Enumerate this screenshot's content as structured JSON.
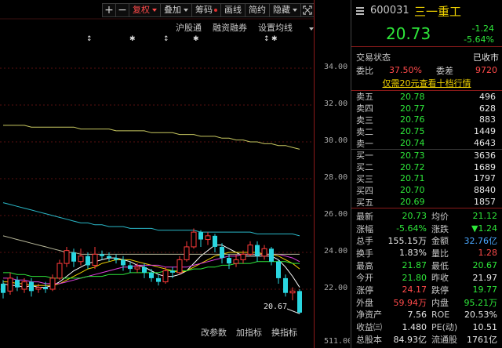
{
  "toolbar": {
    "plus": "+",
    "minus": "−",
    "restore_right": "复权",
    "overlay": "叠加",
    "chips": "筹码",
    "drawing": "画线",
    "brief": "简约",
    "hide": "隐藏"
  },
  "subbar": {
    "hsgt": "沪股通",
    "margin": "融资融券",
    "ma_settings": "设置均线"
  },
  "bottom_tools": {
    "edit_params": "改参数",
    "add_indicator": "加指标",
    "switch_indicator": "换指标"
  },
  "price_axis": {
    "ticks": [
      "34.00",
      "32.00",
      "30.00",
      "28.00",
      "26.00",
      "24.00",
      "22.00"
    ],
    "bottom_label": "511.00"
  },
  "chart_annotation": {
    "low_price": "20.67"
  },
  "chart_data": {
    "type": "candlestick",
    "ylim": [
      20.0,
      35.0
    ],
    "candles": [
      {
        "o": 22.3,
        "c": 21.8,
        "h": 22.5,
        "l": 21.5
      },
      {
        "o": 21.9,
        "c": 22.6,
        "h": 22.9,
        "l": 21.7
      },
      {
        "o": 22.5,
        "c": 22.1,
        "h": 22.7,
        "l": 21.9
      },
      {
        "o": 22.0,
        "c": 22.4,
        "h": 22.6,
        "l": 21.8
      },
      {
        "o": 22.4,
        "c": 21.9,
        "h": 22.6,
        "l": 21.6
      },
      {
        "o": 22.0,
        "c": 22.1,
        "h": 22.3,
        "l": 21.8
      },
      {
        "o": 22.1,
        "c": 22.0,
        "h": 22.4,
        "l": 21.8
      },
      {
        "o": 22.0,
        "c": 22.6,
        "h": 22.8,
        "l": 21.9
      },
      {
        "o": 22.6,
        "c": 23.4,
        "h": 23.6,
        "l": 22.5
      },
      {
        "o": 23.4,
        "c": 24.1,
        "h": 24.3,
        "l": 23.2
      },
      {
        "o": 24.0,
        "c": 23.5,
        "h": 24.2,
        "l": 23.2
      },
      {
        "o": 23.5,
        "c": 23.8,
        "h": 24.2,
        "l": 23.3
      },
      {
        "o": 23.8,
        "c": 23.3,
        "h": 24.0,
        "l": 23.1
      },
      {
        "o": 23.3,
        "c": 23.9,
        "h": 24.3,
        "l": 23.1
      },
      {
        "o": 23.9,
        "c": 23.8,
        "h": 24.1,
        "l": 23.6
      },
      {
        "o": 23.8,
        "c": 23.7,
        "h": 24.0,
        "l": 23.5
      },
      {
        "o": 23.7,
        "c": 23.6,
        "h": 23.9,
        "l": 23.4
      },
      {
        "o": 23.6,
        "c": 23.3,
        "h": 23.8,
        "l": 23.0
      },
      {
        "o": 23.3,
        "c": 23.1,
        "h": 23.5,
        "l": 22.9
      },
      {
        "o": 23.1,
        "c": 23.2,
        "h": 23.4,
        "l": 22.9
      },
      {
        "o": 23.2,
        "c": 22.9,
        "h": 23.4,
        "l": 22.6
      },
      {
        "o": 22.9,
        "c": 22.6,
        "h": 23.1,
        "l": 22.4
      },
      {
        "o": 22.6,
        "c": 22.4,
        "h": 22.8,
        "l": 22.2
      },
      {
        "o": 22.4,
        "c": 23.0,
        "h": 23.2,
        "l": 22.3
      },
      {
        "o": 23.0,
        "c": 22.9,
        "h": 23.2,
        "l": 22.6
      },
      {
        "o": 22.9,
        "c": 23.6,
        "h": 23.8,
        "l": 22.8
      },
      {
        "o": 23.6,
        "c": 24.3,
        "h": 24.6,
        "l": 23.5
      },
      {
        "o": 24.3,
        "c": 25.1,
        "h": 25.3,
        "l": 24.2
      },
      {
        "o": 25.1,
        "c": 24.7,
        "h": 25.2,
        "l": 24.3
      },
      {
        "o": 24.7,
        "c": 24.9,
        "h": 25.1,
        "l": 24.4
      },
      {
        "o": 24.9,
        "c": 24.3,
        "h": 25.0,
        "l": 24.0
      },
      {
        "o": 24.3,
        "c": 23.7,
        "h": 24.5,
        "l": 23.4
      },
      {
        "o": 23.7,
        "c": 23.4,
        "h": 23.9,
        "l": 23.1
      },
      {
        "o": 23.4,
        "c": 23.6,
        "h": 23.9,
        "l": 23.2
      },
      {
        "o": 23.6,
        "c": 23.9,
        "h": 24.1,
        "l": 23.4
      },
      {
        "o": 23.9,
        "c": 24.4,
        "h": 24.6,
        "l": 23.8
      },
      {
        "o": 24.4,
        "c": 23.8,
        "h": 24.6,
        "l": 23.5
      },
      {
        "o": 23.8,
        "c": 24.2,
        "h": 24.4,
        "l": 23.6
      },
      {
        "o": 24.2,
        "c": 23.5,
        "h": 24.3,
        "l": 23.3
      },
      {
        "o": 23.5,
        "c": 22.6,
        "h": 23.6,
        "l": 22.3
      },
      {
        "o": 22.6,
        "c": 21.8,
        "h": 22.8,
        "l": 21.6
      },
      {
        "o": 21.8,
        "c": 21.9,
        "h": 22.1,
        "l": 21.4
      },
      {
        "o": 21.9,
        "c": 20.73,
        "h": 22.0,
        "l": 20.67
      }
    ],
    "ma_lines": [
      {
        "color": "#ffffff",
        "values": [
          22.3,
          22.2,
          22.2,
          22.1,
          22.2,
          22.1,
          22.1,
          22.2,
          22.4,
          22.7,
          23.0,
          23.2,
          23.4,
          23.5,
          23.6,
          23.7,
          23.7,
          23.6,
          23.5,
          23.3,
          23.2,
          23.0,
          22.8,
          22.7,
          22.7,
          22.8,
          23.0,
          23.4,
          23.8,
          24.1,
          24.4,
          24.4,
          24.2,
          24.0,
          23.8,
          23.8,
          23.8,
          23.8,
          23.8,
          23.6,
          23.2,
          22.7,
          22.1
        ]
      },
      {
        "color": "#f0d200",
        "values": [
          22.4,
          22.4,
          22.3,
          22.3,
          22.2,
          22.2,
          22.2,
          22.2,
          22.3,
          22.5,
          22.7,
          22.9,
          23.1,
          23.2,
          23.4,
          23.5,
          23.6,
          23.6,
          23.6,
          23.5,
          23.4,
          23.3,
          23.2,
          23.1,
          23.0,
          22.9,
          23.0,
          23.2,
          23.4,
          23.6,
          23.8,
          23.9,
          24.0,
          24.0,
          24.0,
          24.0,
          24.0,
          23.9,
          23.9,
          23.8,
          23.6,
          23.4,
          23.1
        ]
      },
      {
        "color": "#e040e0",
        "values": [
          22.6,
          22.6,
          22.5,
          22.5,
          22.4,
          22.4,
          22.3,
          22.3,
          22.3,
          22.4,
          22.5,
          22.6,
          22.7,
          22.8,
          22.9,
          23.0,
          23.1,
          23.2,
          23.2,
          23.3,
          23.3,
          23.3,
          23.3,
          23.2,
          23.2,
          23.2,
          23.2,
          23.3,
          23.4,
          23.5,
          23.6,
          23.7,
          23.8,
          23.8,
          23.9,
          23.9,
          23.9,
          23.9,
          23.9,
          23.9,
          23.8,
          23.7,
          23.5
        ]
      },
      {
        "color": "#2ee83a",
        "values": [
          22.9,
          22.9,
          22.8,
          22.8,
          22.7,
          22.7,
          22.7,
          22.6,
          22.6,
          22.6,
          22.6,
          22.6,
          22.7,
          22.7,
          22.7,
          22.8,
          22.8,
          22.8,
          22.9,
          22.9,
          22.9,
          22.9,
          22.9,
          23.0,
          23.0,
          23.0,
          23.0,
          23.1,
          23.1,
          23.2,
          23.2,
          23.3,
          23.3,
          23.4,
          23.4,
          23.4,
          23.5,
          23.5,
          23.5,
          23.5,
          23.5,
          23.4,
          23.4
        ]
      },
      {
        "color": "#b8b89a",
        "values": [
          24.9,
          24.8,
          24.7,
          24.6,
          24.5,
          24.4,
          24.3,
          24.2,
          24.1,
          24.0,
          24.0,
          23.9,
          23.9,
          23.9,
          23.9,
          23.9,
          23.9,
          23.9,
          23.9,
          23.9,
          23.9,
          23.9,
          23.9,
          23.9,
          23.9,
          23.9,
          23.9,
          23.9,
          23.9,
          23.9,
          23.9,
          23.9,
          23.9,
          23.9,
          23.9,
          23.9,
          23.9,
          23.9,
          23.9,
          23.9,
          23.9,
          23.9,
          23.9
        ]
      },
      {
        "color": "#2ab8c8",
        "values": [
          26.7,
          26.6,
          26.5,
          26.4,
          26.3,
          26.2,
          26.1,
          26.0,
          25.9,
          25.8,
          25.7,
          25.6,
          25.6,
          25.5,
          25.5,
          25.4,
          25.4,
          25.4,
          25.3,
          25.3,
          25.3,
          25.3,
          25.2,
          25.2,
          25.2,
          25.2,
          25.2,
          25.2,
          25.1,
          25.1,
          25.1,
          25.1,
          25.1,
          25.1,
          25.1,
          25.1,
          25.0,
          25.0,
          25.0,
          25.0,
          25.0,
          25.0,
          24.9
        ]
      },
      {
        "color": "#c8c860",
        "values": [
          30.9,
          30.9,
          30.9,
          30.9,
          30.8,
          30.8,
          30.8,
          30.8,
          30.8,
          30.8,
          30.8,
          30.7,
          30.7,
          30.7,
          30.7,
          30.7,
          30.6,
          30.6,
          30.6,
          30.6,
          30.6,
          30.5,
          30.5,
          30.5,
          30.5,
          30.4,
          30.4,
          30.4,
          30.3,
          30.3,
          30.3,
          30.2,
          30.2,
          30.1,
          30.1,
          30.0,
          30.0,
          29.9,
          29.9,
          29.8,
          29.8,
          29.7,
          29.6
        ]
      }
    ]
  },
  "quote": {
    "code": "600031",
    "name": "三一重工",
    "price": "20.73",
    "change": "-1.24",
    "change_pct": "-5.64%",
    "status_label": "交易状态",
    "status_value": "已收市",
    "ratio_label": "委比",
    "ratio_value": "37.50%",
    "diff_label": "委差",
    "diff_value": "9720",
    "level10_link": "仅需20元查看十档行情",
    "asks": [
      {
        "label": "卖五",
        "price": "20.78",
        "vol": "496"
      },
      {
        "label": "卖四",
        "price": "20.77",
        "vol": "628"
      },
      {
        "label": "卖三",
        "price": "20.76",
        "vol": "883"
      },
      {
        "label": "卖二",
        "price": "20.75",
        "vol": "1449"
      },
      {
        "label": "卖一",
        "price": "20.74",
        "vol": "4643"
      }
    ],
    "bids": [
      {
        "label": "买一",
        "price": "20.73",
        "vol": "3636"
      },
      {
        "label": "买二",
        "price": "20.72",
        "vol": "1689"
      },
      {
        "label": "买三",
        "price": "20.71",
        "vol": "1797"
      },
      {
        "label": "买四",
        "price": "20.70",
        "vol": "8840"
      },
      {
        "label": "买五",
        "price": "20.69",
        "vol": "1857"
      }
    ],
    "stats": [
      {
        "k1": "最新",
        "v1": "20.73",
        "c1": "green",
        "k2": "均价",
        "v2": "21.12",
        "c2": "green"
      },
      {
        "k1": "涨幅",
        "v1": "-5.64%",
        "c1": "green",
        "k2": "涨跌",
        "v2": "▼1.24",
        "c2": "green"
      },
      {
        "k1": "总手",
        "v1": "155.15万",
        "c1": "white",
        "k2": "金额",
        "v2": "32.76亿",
        "c2": "blue"
      },
      {
        "k1": "换手",
        "v1": "1.83%",
        "c1": "white",
        "k2": "量比",
        "v2": "1.28",
        "c2": "red"
      },
      {
        "k1": "最高",
        "v1": "21.87",
        "c1": "green",
        "k2": "最低",
        "v2": "20.67",
        "c2": "green"
      },
      {
        "k1": "今开",
        "v1": "21.80",
        "c1": "green",
        "k2": "昨收",
        "v2": "21.97",
        "c2": "white"
      },
      {
        "k1": "涨停",
        "v1": "24.17",
        "c1": "red",
        "k2": "跌停",
        "v2": "19.77",
        "c2": "green"
      },
      {
        "k1": "外盘",
        "v1": "59.94万",
        "c1": "red",
        "k2": "内盘",
        "v2": "95.21万",
        "c2": "green"
      },
      {
        "k1": "净资产",
        "v1": "7.56",
        "c1": "white",
        "k2": "ROE",
        "v2": "20.53%",
        "c2": "white"
      },
      {
        "k1": "收益㈢",
        "v1": "1.480",
        "c1": "white",
        "k2": "PE(动)",
        "v2": "10.51",
        "c2": "white"
      },
      {
        "k1": "总股本",
        "v1": "84.93亿",
        "c1": "white",
        "k2": "流通股",
        "v2": "1761亿",
        "c2": "white"
      }
    ]
  }
}
